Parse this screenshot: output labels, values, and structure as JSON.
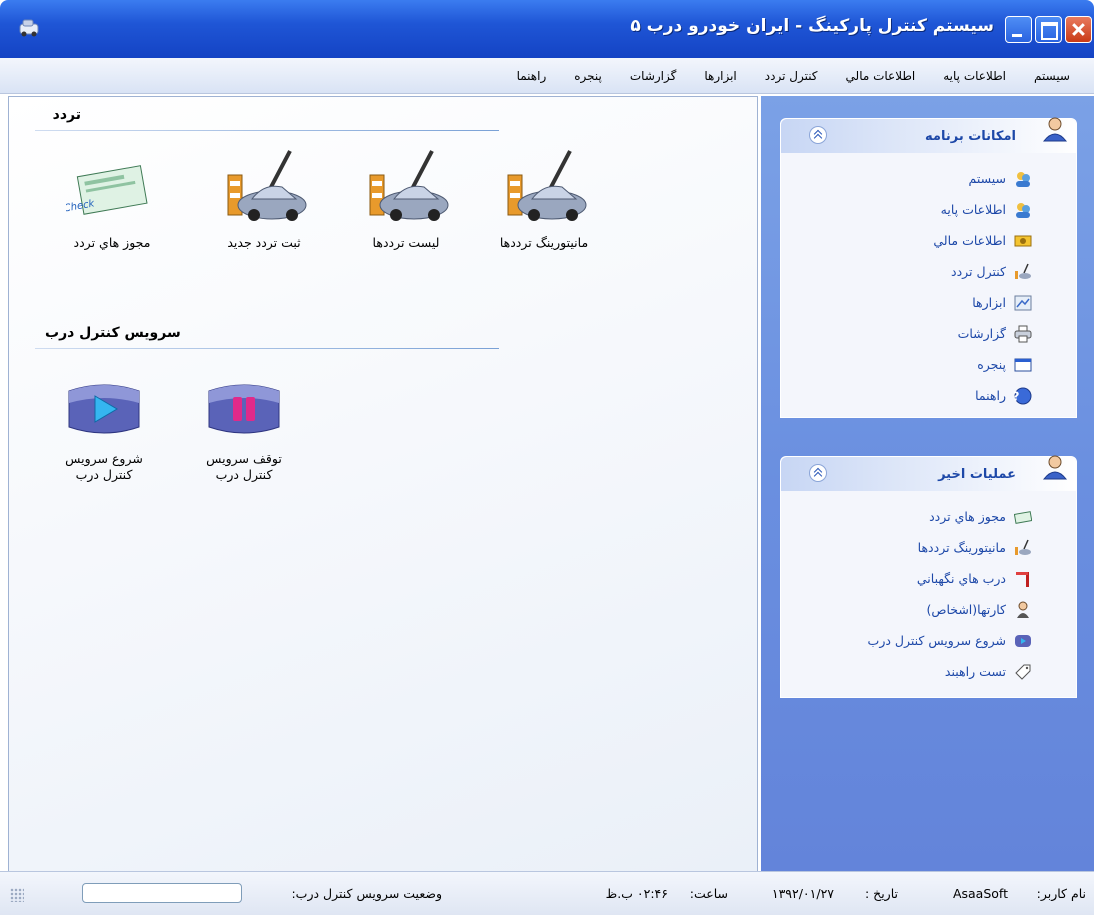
{
  "window": {
    "title": "سيستم کنترل پارکينگ - ايران خودرو درب ۵"
  },
  "menu": [
    "سيستم",
    "اطلاعات پايه",
    "اطلاعات مالي",
    "کنترل تردد",
    "ابزارها",
    "گزارشات",
    "پنجره",
    "راهنما"
  ],
  "content": {
    "section1": {
      "title": "تردد",
      "tiles": [
        {
          "label": "مانيتورينگ ترددها",
          "icon": "car-barrier-pen-icon"
        },
        {
          "label": "ليست ترددها",
          "icon": "car-barrier-pen-icon"
        },
        {
          "label": "ثبت تردد جديد",
          "icon": "car-barrier-pen-icon"
        },
        {
          "label": "مجوز هاي تردد",
          "icon": "check-document-icon"
        }
      ]
    },
    "section2": {
      "title": "سرويس کنترل درب",
      "tiles": [
        {
          "label_line1": "توقف سرويس",
          "label_line2": "کنترل درب",
          "icon": "pause-icon"
        },
        {
          "label_line1": "شروع سرويس",
          "label_line2": "کنترل درب",
          "icon": "play-icon"
        }
      ]
    }
  },
  "sidebar": {
    "panel1": {
      "title": "امکانات برنامه",
      "items": [
        {
          "label": "سيستم",
          "icon": "users-icon"
        },
        {
          "label": "اطلاعات پايه",
          "icon": "users-icon"
        },
        {
          "label": "اطلاعات مالي",
          "icon": "money-icon"
        },
        {
          "label": "کنترل تردد",
          "icon": "car-icon"
        },
        {
          "label": "ابزارها",
          "icon": "tools-icon"
        },
        {
          "label": "گزارشات",
          "icon": "printer-icon"
        },
        {
          "label": "پنجره",
          "icon": "window-icon"
        },
        {
          "label": "راهنما",
          "icon": "help-icon"
        }
      ]
    },
    "panel2": {
      "title": "عمليات اخير",
      "items": [
        {
          "label": "مجوز هاي تردد",
          "icon": "check-icon"
        },
        {
          "label": "مانيتورينگ ترددها",
          "icon": "car-icon"
        },
        {
          "label": "درب هاي نگهباني",
          "icon": "barrier-icon"
        },
        {
          "label": "کارتها(اشخاص)",
          "icon": "person-icon"
        },
        {
          "label": "شروع سرويس کنترل درب",
          "icon": "play-icon"
        },
        {
          "label": "تست راهبند",
          "icon": "tag-icon"
        }
      ]
    }
  },
  "status": {
    "user_label": "نام کاربر:",
    "user_value": "AsaaSoft",
    "date_label": "تاريخ :",
    "date_value": "۱۳۹۲/۰۱/۲۷",
    "time_label": "ساعت:",
    "time_value": "۰۲:۴۶ ب.ظ",
    "service_label": "وضعيت سرويس کنترل درب:"
  },
  "colors": {
    "titlebar": "#1f56d6",
    "sidebar": "#6a8fe0",
    "link": "#1d48a8"
  }
}
